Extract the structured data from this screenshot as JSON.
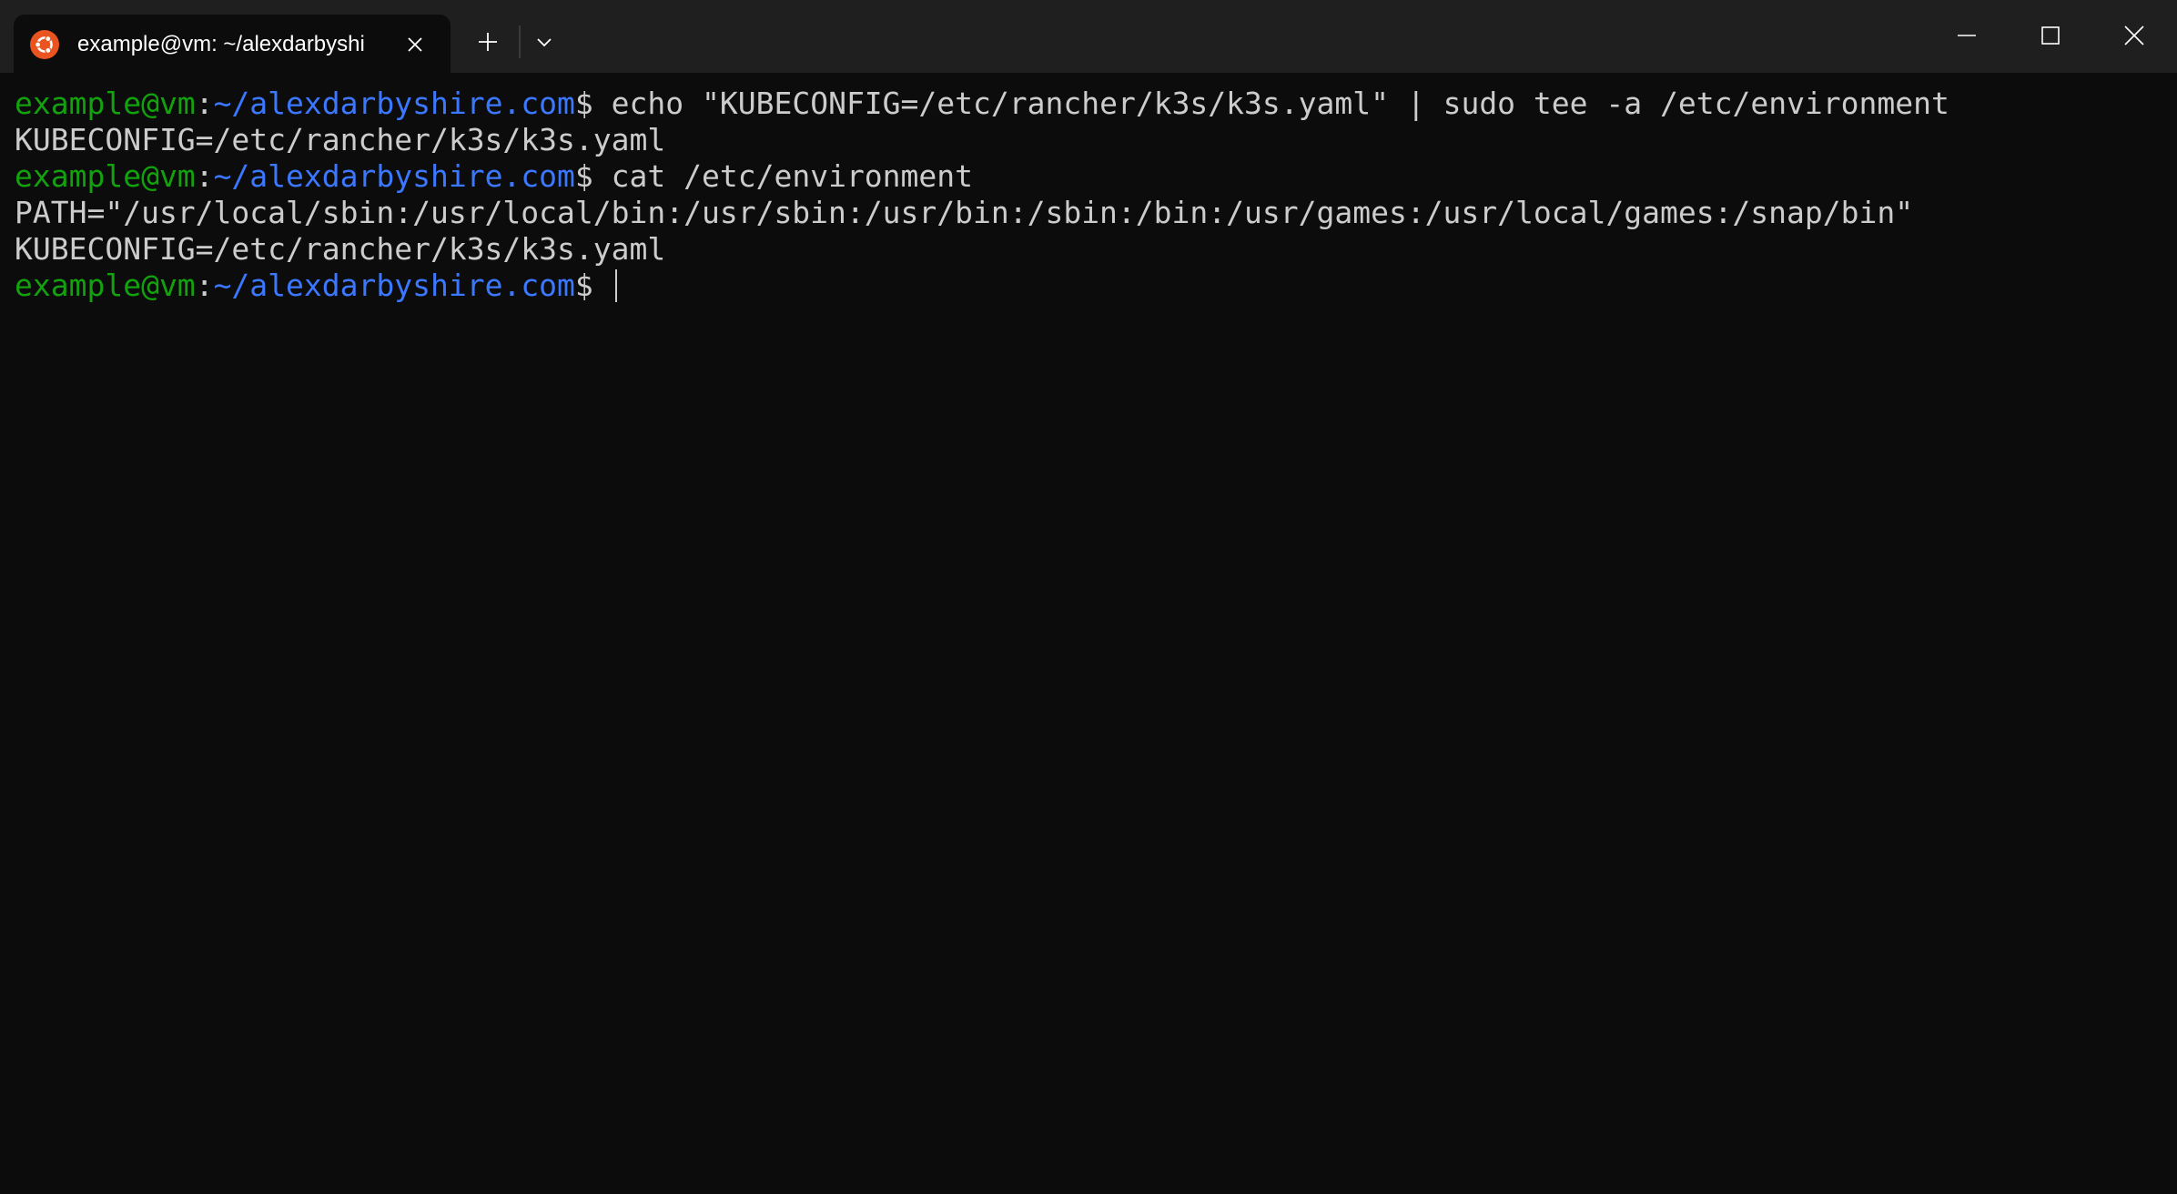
{
  "tab": {
    "title": "example@vm: ~/alexdarbyshi",
    "icon": "ubuntu-icon",
    "icon_color": "#e95420"
  },
  "titlebar_icons": {
    "close_tab": "close-icon",
    "new_tab": "plus-icon",
    "dropdown": "chevron-down-icon",
    "minimize": "minimize-icon",
    "maximize": "maximize-icon",
    "close_window": "close-icon"
  },
  "colors": {
    "prompt_user": "#13a10e",
    "prompt_path": "#3b78ff",
    "text": "#cccccc",
    "background": "#0c0c0c"
  },
  "terminal": {
    "lines": [
      {
        "type": "prompt",
        "user": "example@vm",
        "sep": ":",
        "path": "~/alexdarbyshire.com",
        "dollar": "$",
        "command": " echo \"KUBECONFIG=/etc/rancher/k3s/k3s.yaml\" | sudo tee -a /etc/environment"
      },
      {
        "type": "output",
        "text": "KUBECONFIG=/etc/rancher/k3s/k3s.yaml"
      },
      {
        "type": "prompt",
        "user": "example@vm",
        "sep": ":",
        "path": "~/alexdarbyshire.com",
        "dollar": "$",
        "command": " cat /etc/environment"
      },
      {
        "type": "output",
        "text": "PATH=\"/usr/local/sbin:/usr/local/bin:/usr/sbin:/usr/bin:/sbin:/bin:/usr/games:/usr/local/games:/snap/bin\""
      },
      {
        "type": "output",
        "text": "KUBECONFIG=/etc/rancher/k3s/k3s.yaml"
      },
      {
        "type": "prompt",
        "user": "example@vm",
        "sep": ":",
        "path": "~/alexdarbyshire.com",
        "dollar": "$",
        "command": " "
      }
    ]
  }
}
